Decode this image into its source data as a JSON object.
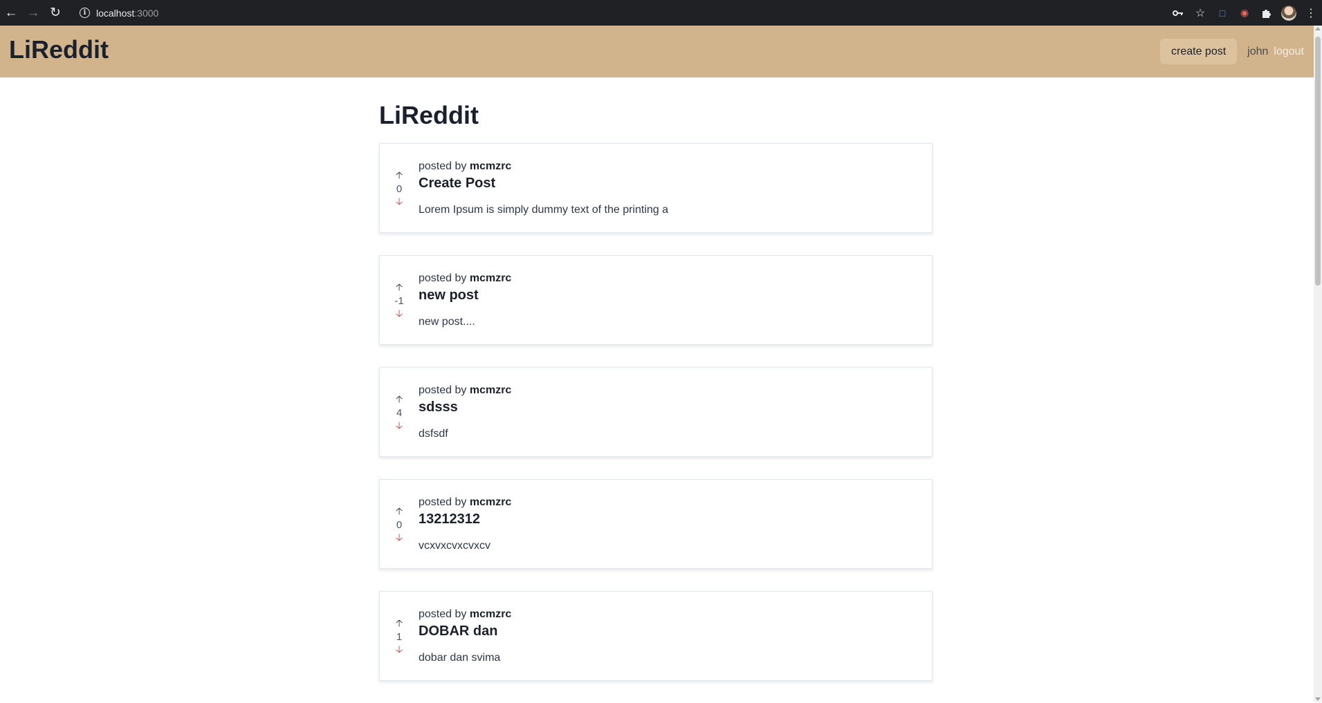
{
  "browser": {
    "url_host": "localhost",
    "url_port": ":3000"
  },
  "navbar": {
    "logo": "LiReddit",
    "create_post_label": "create post",
    "username": "john",
    "logout_label": "logout"
  },
  "main": {
    "page_title": "LiReddit",
    "posted_by_prefix": "posted by",
    "posts": [
      {
        "points": "0",
        "author": "mcmzrc",
        "title": "Create Post",
        "snippet": "Lorem Ipsum is simply dummy text of the printing a"
      },
      {
        "points": "-1",
        "author": "mcmzrc",
        "title": "new post",
        "snippet": "new post...."
      },
      {
        "points": "4",
        "author": "mcmzrc",
        "title": "sdsss",
        "snippet": "dsfsdf"
      },
      {
        "points": "0",
        "author": "mcmzrc",
        "title": "13212312",
        "snippet": "vcxvxcvxcvxcv"
      },
      {
        "points": "1",
        "author": "mcmzrc",
        "title": "DOBAR dan",
        "snippet": "dobar dan svima"
      }
    ]
  },
  "colors": {
    "navbar_bg": "#d2b48c",
    "upvote": "#1a202c",
    "downvote": "#c53030"
  },
  "icons": {
    "back": "arrow-left-icon",
    "forward": "arrow-right-icon",
    "reload": "reload-icon",
    "site_info": "info-icon",
    "password": "key-icon",
    "bookmark": "star-icon",
    "extensions": "puzzle-icon",
    "menu": "kebab-menu-icon",
    "upvote": "arrow-up-icon",
    "downvote": "arrow-down-icon"
  }
}
